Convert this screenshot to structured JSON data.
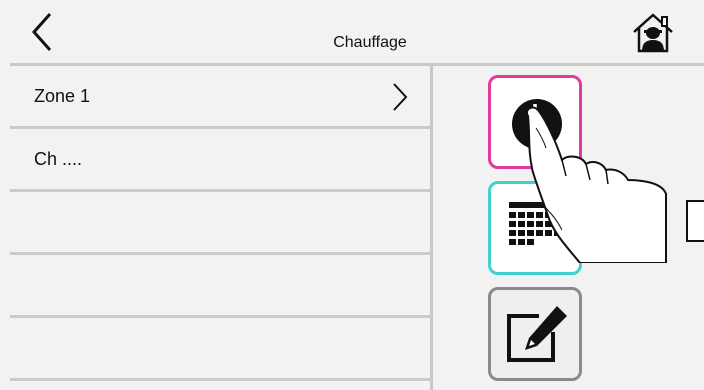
{
  "header": {
    "title": "Chauffage",
    "back_icon": "chevron-left-icon",
    "home_icon": "home-person-icon"
  },
  "list": {
    "items": [
      {
        "label": "Zone 1",
        "has_chevron": true
      },
      {
        "label": "Ch ....",
        "has_chevron": false
      },
      {
        "label": "",
        "has_chevron": false
      },
      {
        "label": "",
        "has_chevron": false
      },
      {
        "label": "",
        "has_chevron": false
      }
    ]
  },
  "actions": [
    {
      "name": "clock",
      "icon": "clock-icon",
      "border_color": "#e0399f"
    },
    {
      "name": "calendar",
      "icon": "calendar-icon",
      "border_color": "#3fd0cf"
    },
    {
      "name": "edit",
      "icon": "edit-icon",
      "border_color": "#8a8a8a"
    }
  ],
  "overlay": {
    "icon": "pointing-hand-icon"
  }
}
